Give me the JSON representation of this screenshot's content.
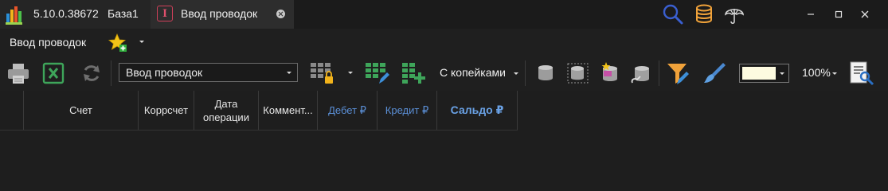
{
  "titlebar": {
    "version": "5.10.0.38672",
    "database": "База1",
    "doc_tab": {
      "label": "Ввод проводок",
      "icon": "i-document-icon"
    }
  },
  "subheader": {
    "title": "Ввод проводок"
  },
  "toolbar": {
    "report_combo_value": "Ввод проводок",
    "kopeks_label": "С копейками",
    "zoom_label": "100%",
    "color_swatch": "#fdfbe0"
  },
  "grid": {
    "columns": [
      {
        "label": "Счет"
      },
      {
        "label": "Коррсчет"
      },
      {
        "label": "Дата операции"
      },
      {
        "label": "Коммент..."
      },
      {
        "label": "Дебет ₽"
      },
      {
        "label": "Кредит ₽"
      },
      {
        "label": "Сальдо ₽"
      }
    ]
  },
  "colors": {
    "accent_blue": "#5b8fd6",
    "balance_blue": "#6aa2e6",
    "orange": "#f0a23a"
  }
}
